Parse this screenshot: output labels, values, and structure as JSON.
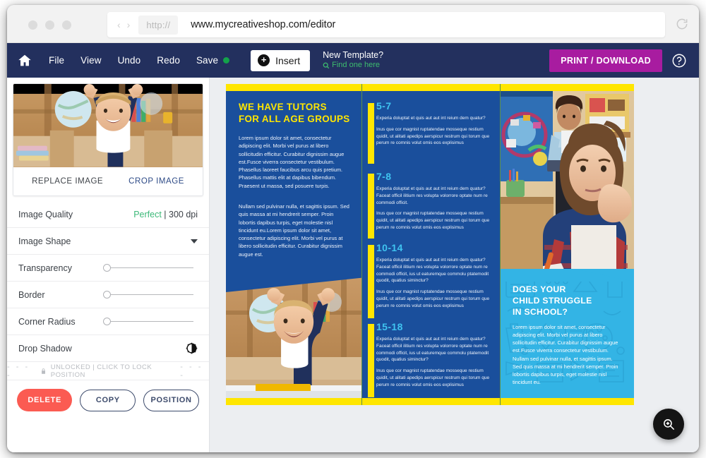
{
  "browser": {
    "scheme_label": "http://",
    "url": "www.mycreativeshop.com/editor",
    "back_glyph": "‹",
    "forward_glyph": "›"
  },
  "toolbar": {
    "home_icon": "home-icon",
    "menu": [
      "File",
      "View",
      "Undo",
      "Redo"
    ],
    "save_label": "Save",
    "insert_label": "Insert",
    "new_template_title": "New Template?",
    "new_template_link": "Find one here",
    "print_download_label": "PRINT / DOWNLOAD",
    "help_icon": "help-icon",
    "accent_purple": "#a81ca0",
    "bar_navy": "#23305e",
    "save_dot_color": "#13a24a"
  },
  "sidebar": {
    "thumbnail_actions": {
      "replace": "REPLACE IMAGE",
      "crop": "CROP IMAGE"
    },
    "options": [
      {
        "label": "Image Quality",
        "value_good": "Perfect",
        "value_rest": " | 300 dpi",
        "type": "value"
      },
      {
        "label": "Image Shape",
        "type": "dropdown"
      },
      {
        "label": "Transparency",
        "type": "slider",
        "position": 0
      },
      {
        "label": "Border",
        "type": "slider",
        "position": 0
      },
      {
        "label": "Corner Radius",
        "type": "slider",
        "position": 0
      },
      {
        "label": "Drop Shadow",
        "type": "toggle-icon"
      }
    ],
    "lock_row": {
      "left_dashes": "-  -  -  -",
      "text": "UNLOCKED | CLICK TO LOCK POSITION",
      "right_dashes": "-  -  -  -"
    },
    "buttons": {
      "delete": "DELETE",
      "copy": "COPY",
      "position": "POSITION"
    },
    "colors": {
      "delete": "#fb5b52",
      "outline": "#3c4a6b",
      "good": "#3cb878"
    }
  },
  "canvas": {
    "zoom_fab_icon": "zoom-in-icon",
    "brochure": {
      "background": "#1a4f9c",
      "accent_yellow": "#ffe600",
      "accent_cyan": "#3fc3f0",
      "panel_left": {
        "headline_line1": "WE HAVE TUTORS",
        "headline_line2": "FOR ALL AGE GROUPS",
        "paragraph_1": "Lorem ipsum dolor sit amet, consectetur adipiscing elit. Morbi vel purus at libero sollicitudin efficitur. Curabitur dignissim augue est.Fusce viverra consectetur vestibulum. Phasellus laoreet faucibus arcu quis pretium. Phasellus mattis elit at dapibus bibendum. Praesent ut massa, sed posuere turpis.",
        "paragraph_2": "Nullam sed pulvinar nulla, et sagittis ipsum. Sed quis massa at mi hendrerit semper. Proin lobortis dapibus turpis, eget molestie nisl tincidunt eu.Lorem ipsum dolor sit amet, consectetur adipiscing elit. Morbi vel purus at libero sollicitudin efficitur. Curabitur dignissim augue est.",
        "photo_alt": "boy-cheering-at-desk"
      },
      "panel_mid": {
        "age_groups": [
          {
            "title": "5-7",
            "question": "Experia doluptat et quis aut aut int reium dem quatur?",
            "answer": "Inus que cor magnist ruptatendae mosseque restium quidit, ut alitati apedips aerspicur restrum qui torum que perum re comnis volut omis eos explisimus"
          },
          {
            "title": "7-8",
            "question": "Experia doluptat et quis aut aut int reium dem quatur? Faceat officil ilitium res volupta volorrore optate num re commodi officit.",
            "answer": "Inus que cor magnist ruptatendae mosseque restium quidit, ut alitati apedips aerspicur restrum qui torum que perum re comnis volut omis eos explisimus"
          },
          {
            "title": "10-14",
            "question": "Experia doluptat et quis aut aut int reium dem quatur? Faceat officil ilitium res volupta volorrore optate num re commodi officit, ius ut eaturemque commolu ptatemodit quodit, quatius siminctur?",
            "answer": "Inus que cor magnist ruptatendae mosseque restium quidit, ut alitati apedips aerspicur restrum qui torum que perum re comnis volut omis eos explisimus"
          },
          {
            "title": "15-18",
            "question": "Experia doluptat et quis aut aut int reium dem quatur? Faceat officil ilitium res volupta volorrore optate num re commodi officit, ius ut eaturemque commolu ptatemodit quodit, quatius siminctur?",
            "answer": "Inus que cor magnist ruptatendae mosseque restium quidit, ut alitati apedips aerspicur restrum qui torum que perum re comnis volut omis eos explisimus"
          }
        ]
      },
      "panel_right": {
        "photo_alt": "girl-bored-in-classroom-with-teacher",
        "headline_line1": "DOES YOUR",
        "headline_line2": "CHILD STRUGGLE",
        "headline_line3": "IN SCHOOL?",
        "paragraph_1": "Lorem ipsum dolor sit amet, consectetur adipiscing elit. Morbi vel purus at libero sollicitudin efficitur. Curabitur dignissim augue est.Fusce viverra consectetur vestibulum.",
        "paragraph_2": "Nullam sed pulvinar nulla, et sagittis ipsum. Sed quis massa at mi hendrerit semper. Proin lobortis dapibus turpis, eget molestie nisl tincidunt eu.",
        "card_color": "#33b4e5"
      }
    }
  }
}
